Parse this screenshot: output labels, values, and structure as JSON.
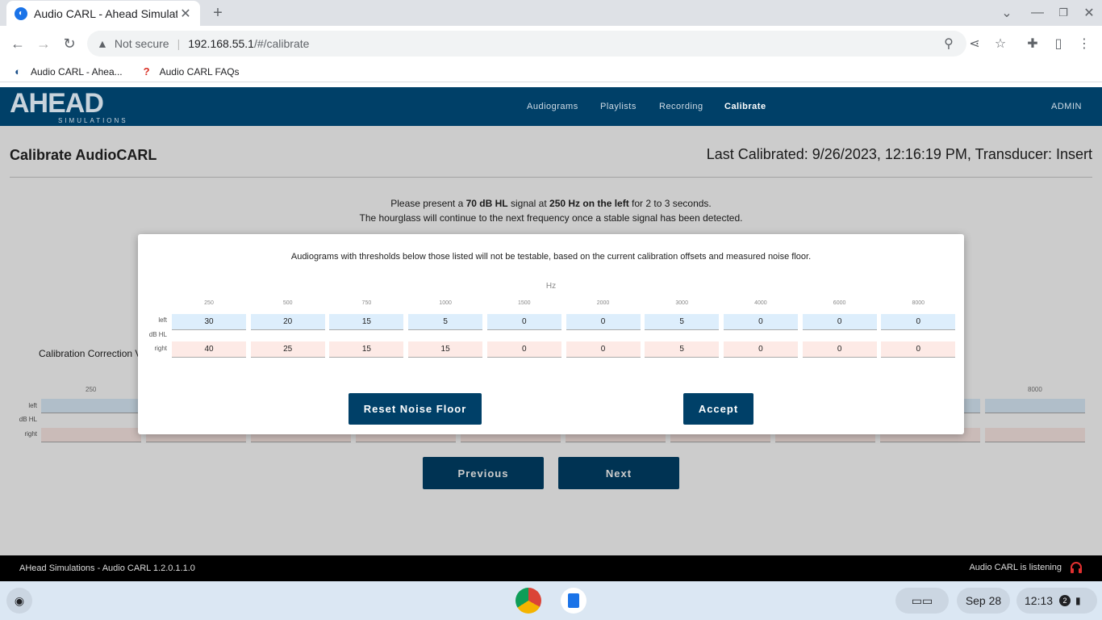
{
  "browser": {
    "tab_title": "Audio CARL - Ahead Simulations",
    "security_label": "Not secure",
    "url_host": "192.168.55.1",
    "url_path": "/#/calibrate",
    "bookmarks": [
      {
        "label": "Audio CARL - Ahea..."
      },
      {
        "label": "Audio CARL FAQs"
      }
    ]
  },
  "app": {
    "logo_main": "AHEAD",
    "logo_sub": "SIMULATIONS",
    "nav": [
      "Audiograms",
      "Playlists",
      "Recording",
      "Calibrate"
    ],
    "admin_label": "ADMIN"
  },
  "page": {
    "title": "Calibrate AudioCARL",
    "last_calibrated": "Last Calibrated: 9/26/2023, 12:16:19 PM, Transducer: Insert",
    "instr_prefix": "Please present a ",
    "instr_level": "70 dB HL",
    "instr_mid": " signal at ",
    "instr_freq": "250 Hz on the left",
    "instr_suffix": " for 2 to 3 seconds.",
    "instr_line2": "The hourglass will continue to the next frequency once a stable signal has been detected.",
    "correction_label": "Calibration Correction V",
    "bg_hz_first": "250",
    "bg_hz_last": "8000",
    "row_left": "left",
    "row_unit": "dB HL",
    "row_right": "right",
    "previous_label": "Previous",
    "next_label": "Next"
  },
  "modal": {
    "message": "Audiograms with thresholds below those listed will not be testable, based on the current calibration offsets and measured noise floor.",
    "hz_label": "Hz",
    "frequencies": [
      "250",
      "500",
      "750",
      "1000",
      "1500",
      "2000",
      "3000",
      "4000",
      "6000",
      "8000"
    ],
    "left_values": [
      "30",
      "20",
      "15",
      "5",
      "0",
      "0",
      "5",
      "0",
      "0",
      "0"
    ],
    "right_values": [
      "40",
      "25",
      "15",
      "15",
      "0",
      "0",
      "5",
      "0",
      "0",
      "0"
    ],
    "row_left": "left",
    "row_unit": "dB HL",
    "row_right": "right",
    "reset_label": "Reset Noise Floor",
    "accept_label": "Accept"
  },
  "footer": {
    "version": "AHead Simulations - Audio CARL 1.2.0.1.1.0",
    "status": "Audio CARL is listening"
  },
  "shelf": {
    "date": "Sep 28",
    "time": "12:13",
    "notif_count": "2"
  },
  "colors": {
    "app_bar": "#004068",
    "left_cell": "#ddeefc",
    "right_cell": "#fdeae6"
  }
}
